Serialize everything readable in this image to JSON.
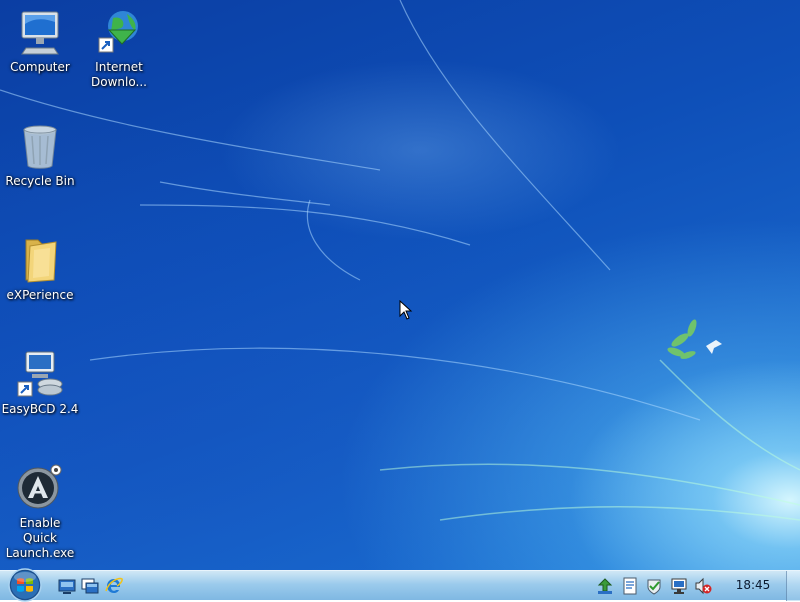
{
  "desktop": {
    "icons": [
      {
        "label": "Computer",
        "icon": "computer-icon"
      },
      {
        "label": "Internet\nDownlo...",
        "icon": "internet-download-manager-icon"
      },
      {
        "label": "Recycle Bin",
        "icon": "recycle-bin-icon"
      },
      {
        "label": "eXPerience",
        "icon": "folder-icon"
      },
      {
        "label": "EasyBCD 2.4",
        "icon": "easybcd-icon"
      },
      {
        "label": "Enable Quick\nLaunch.exe",
        "icon": "quick-launch-exe-icon"
      }
    ]
  },
  "taskbar": {
    "quick_launch": [
      {
        "name": "show-desktop-icon"
      },
      {
        "name": "switch-windows-icon"
      },
      {
        "name": "internet-explorer-icon"
      }
    ],
    "tray": [
      {
        "name": "network-tray-icon"
      },
      {
        "name": "document-tray-icon"
      },
      {
        "name": "security-tray-icon"
      },
      {
        "name": "network-connection-icon"
      },
      {
        "name": "volume-muted-icon"
      }
    ],
    "clock": "18:45"
  },
  "colors": {
    "wallpaper": "#0e4fb8",
    "taskbar": "#9fcbeb"
  }
}
